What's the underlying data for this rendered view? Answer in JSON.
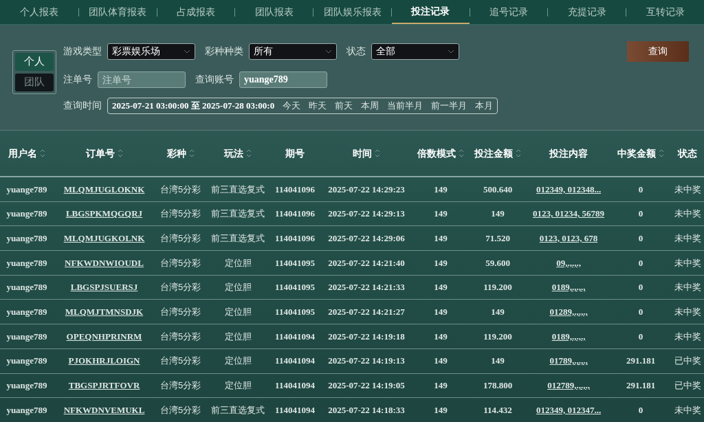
{
  "tabs": [
    {
      "label": "个人报表",
      "selected": false
    },
    {
      "label": "团队体育报表",
      "selected": false
    },
    {
      "label": "占成报表",
      "selected": false
    },
    {
      "label": "团队报表",
      "selected": false
    },
    {
      "label": "团队娱乐报表",
      "selected": false
    },
    {
      "label": "投注记录",
      "selected": true
    },
    {
      "label": "追号记录",
      "selected": false
    },
    {
      "label": "充提记录",
      "selected": false
    },
    {
      "label": "互转记录",
      "selected": false
    }
  ],
  "scope_toggle": [
    {
      "label": "个人",
      "selected": true
    },
    {
      "label": "团队",
      "selected": false
    }
  ],
  "filters": {
    "game_type": {
      "label": "游戏类型",
      "value": "彩票娱乐场"
    },
    "lottery_kind": {
      "label": "彩种种类",
      "value": "所有"
    },
    "status": {
      "label": "状态",
      "value": "全部"
    },
    "order_no": {
      "label": "注单号",
      "placeholder": "注单号"
    },
    "account": {
      "label": "查询账号",
      "value": "yuange789"
    },
    "time": {
      "label": "查询时间",
      "value": "2025-07-21 03:00:00 至 2025-07-28 03:00:0",
      "shortcuts": [
        "今天",
        "昨天",
        "前天",
        "本周",
        "当前半月",
        "前一半月",
        "本月"
      ]
    }
  },
  "query_button": "查询",
  "table": {
    "columns": [
      {
        "label": "用户名",
        "sortable": true
      },
      {
        "label": "订单号",
        "sortable": true
      },
      {
        "label": "彩种",
        "sortable": true
      },
      {
        "label": "玩法",
        "sortable": true
      },
      {
        "label": "期号",
        "sortable": false
      },
      {
        "label": "时间",
        "sortable": true
      },
      {
        "label": "倍数模式",
        "sortable": true
      },
      {
        "label": "投注金额",
        "sortable": true
      },
      {
        "label": "投注内容",
        "sortable": false
      },
      {
        "label": "中奖金额",
        "sortable": true
      },
      {
        "label": "状态",
        "sortable": false
      }
    ],
    "rows": [
      [
        "yuange789",
        "MLQMJUGLOKNK",
        "台湾5分彩",
        "前三直选复式",
        "114041096",
        "2025-07-22 14:29:23",
        "149",
        "500.640",
        "012349, 012348...",
        "0",
        "未中奖"
      ],
      [
        "yuange789",
        "LBGSPKMQGQRJ",
        "台湾5分彩",
        "前三直选复式",
        "114041096",
        "2025-07-22 14:29:13",
        "149",
        "149",
        "0123, 01234, 56789",
        "0",
        "未中奖"
      ],
      [
        "yuange789",
        "MLQMJUGKOLNK",
        "台湾5分彩",
        "前三直选复式",
        "114041096",
        "2025-07-22 14:29:06",
        "149",
        "71.520",
        "0123, 0123, 678",
        "0",
        "未中奖"
      ],
      [
        "yuange789",
        "NFKWDNWIOUDL",
        "台湾5分彩",
        "定位胆",
        "114041095",
        "2025-07-22 14:21:40",
        "149",
        "59.600",
        "09,.,.,.,",
        "0",
        "未中奖"
      ],
      [
        "yuange789",
        "LBGSPJSUERSJ",
        "台湾5分彩",
        "定位胆",
        "114041095",
        "2025-07-22 14:21:33",
        "149",
        "119.200",
        "0189,.,.,.,",
        "0",
        "未中奖"
      ],
      [
        "yuange789",
        "MLQMJTMNSDJK",
        "台湾5分彩",
        "定位胆",
        "114041095",
        "2025-07-22 14:21:27",
        "149",
        "149",
        "01289,.,.,.,",
        "0",
        "未中奖"
      ],
      [
        "yuange789",
        "OPEQNHPRINRM",
        "台湾5分彩",
        "定位胆",
        "114041094",
        "2025-07-22 14:19:18",
        "149",
        "119.200",
        "0189,.,.,.,",
        "0",
        "未中奖"
      ],
      [
        "yuange789",
        "PJOKHRJLOIGN",
        "台湾5分彩",
        "定位胆",
        "114041094",
        "2025-07-22 14:19:13",
        "149",
        "149",
        "01789,.,.,.,",
        "291.181",
        "已中奖"
      ],
      [
        "yuange789",
        "TBGSPJRTFOVR",
        "台湾5分彩",
        "定位胆",
        "114041094",
        "2025-07-22 14:19:05",
        "149",
        "178.800",
        "012789,.,.,.,",
        "291.181",
        "已中奖"
      ],
      [
        "yuange789",
        "NFKWDNVEMUKL",
        "台湾5分彩",
        "前三直选复式",
        "114041094",
        "2025-07-22 14:18:33",
        "149",
        "114.432",
        "012349, 012347...",
        "0",
        "未中奖"
      ]
    ]
  }
}
